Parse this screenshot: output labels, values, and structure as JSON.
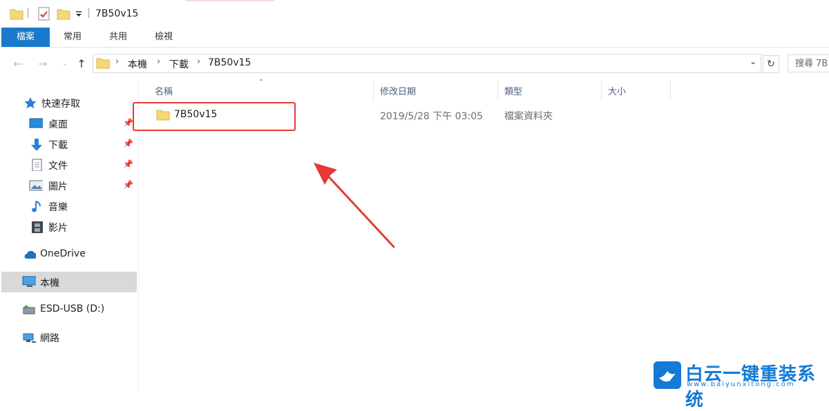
{
  "window": {
    "title": "7B50v15"
  },
  "ribbon": {
    "tabs": [
      {
        "label": "檔案"
      },
      {
        "label": "常用"
      },
      {
        "label": "共用"
      },
      {
        "label": "檢視"
      }
    ]
  },
  "address": {
    "crumbs": [
      "本機",
      "下載",
      "7B50v15"
    ]
  },
  "search": {
    "placeholder": "搜尋 7B"
  },
  "sidebar": {
    "items": [
      {
        "label": "快速存取"
      },
      {
        "label": "桌面"
      },
      {
        "label": "下載"
      },
      {
        "label": "文件"
      },
      {
        "label": "圖片"
      },
      {
        "label": "音樂"
      },
      {
        "label": "影片"
      },
      {
        "label": "OneDrive"
      },
      {
        "label": "本機"
      },
      {
        "label": "ESD-USB (D:)"
      },
      {
        "label": "網路"
      }
    ]
  },
  "columns": {
    "name": "名稱",
    "date": "修改日期",
    "type": "類型",
    "size": "大小"
  },
  "files": [
    {
      "name": "7B50v15",
      "date": "2019/5/28 下午 03:05",
      "type": "檔案資料夾",
      "size": ""
    }
  ],
  "watermark": {
    "main": "白云一键重装系统",
    "sub": "www.baiyunxitong.com"
  },
  "colors": {
    "accent": "#1979ca",
    "highlight": "#e53935",
    "folder": "#f8d775"
  }
}
